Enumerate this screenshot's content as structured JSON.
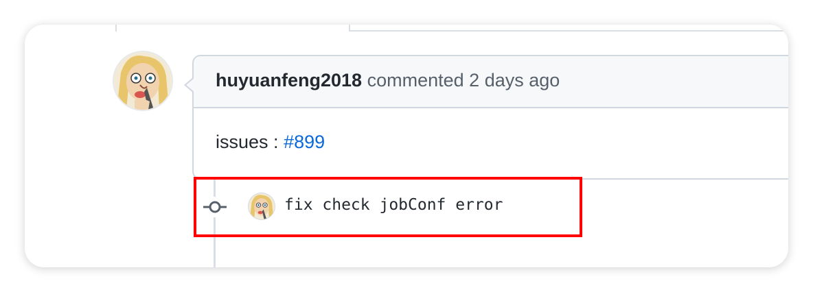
{
  "comment": {
    "author": "huyuanfeng2018",
    "action": "commented",
    "time": "2 days ago",
    "body_prefix": "issues :",
    "issue_link": "#899"
  },
  "commit": {
    "message": "fix check jobConf error"
  },
  "colors": {
    "link": "#0969da",
    "highlight": "#ff0000",
    "header_bg": "#f6f8fa",
    "border": "#d0d7de"
  },
  "icons": {
    "commit": "git-commit-icon",
    "avatar": "user-avatar"
  }
}
